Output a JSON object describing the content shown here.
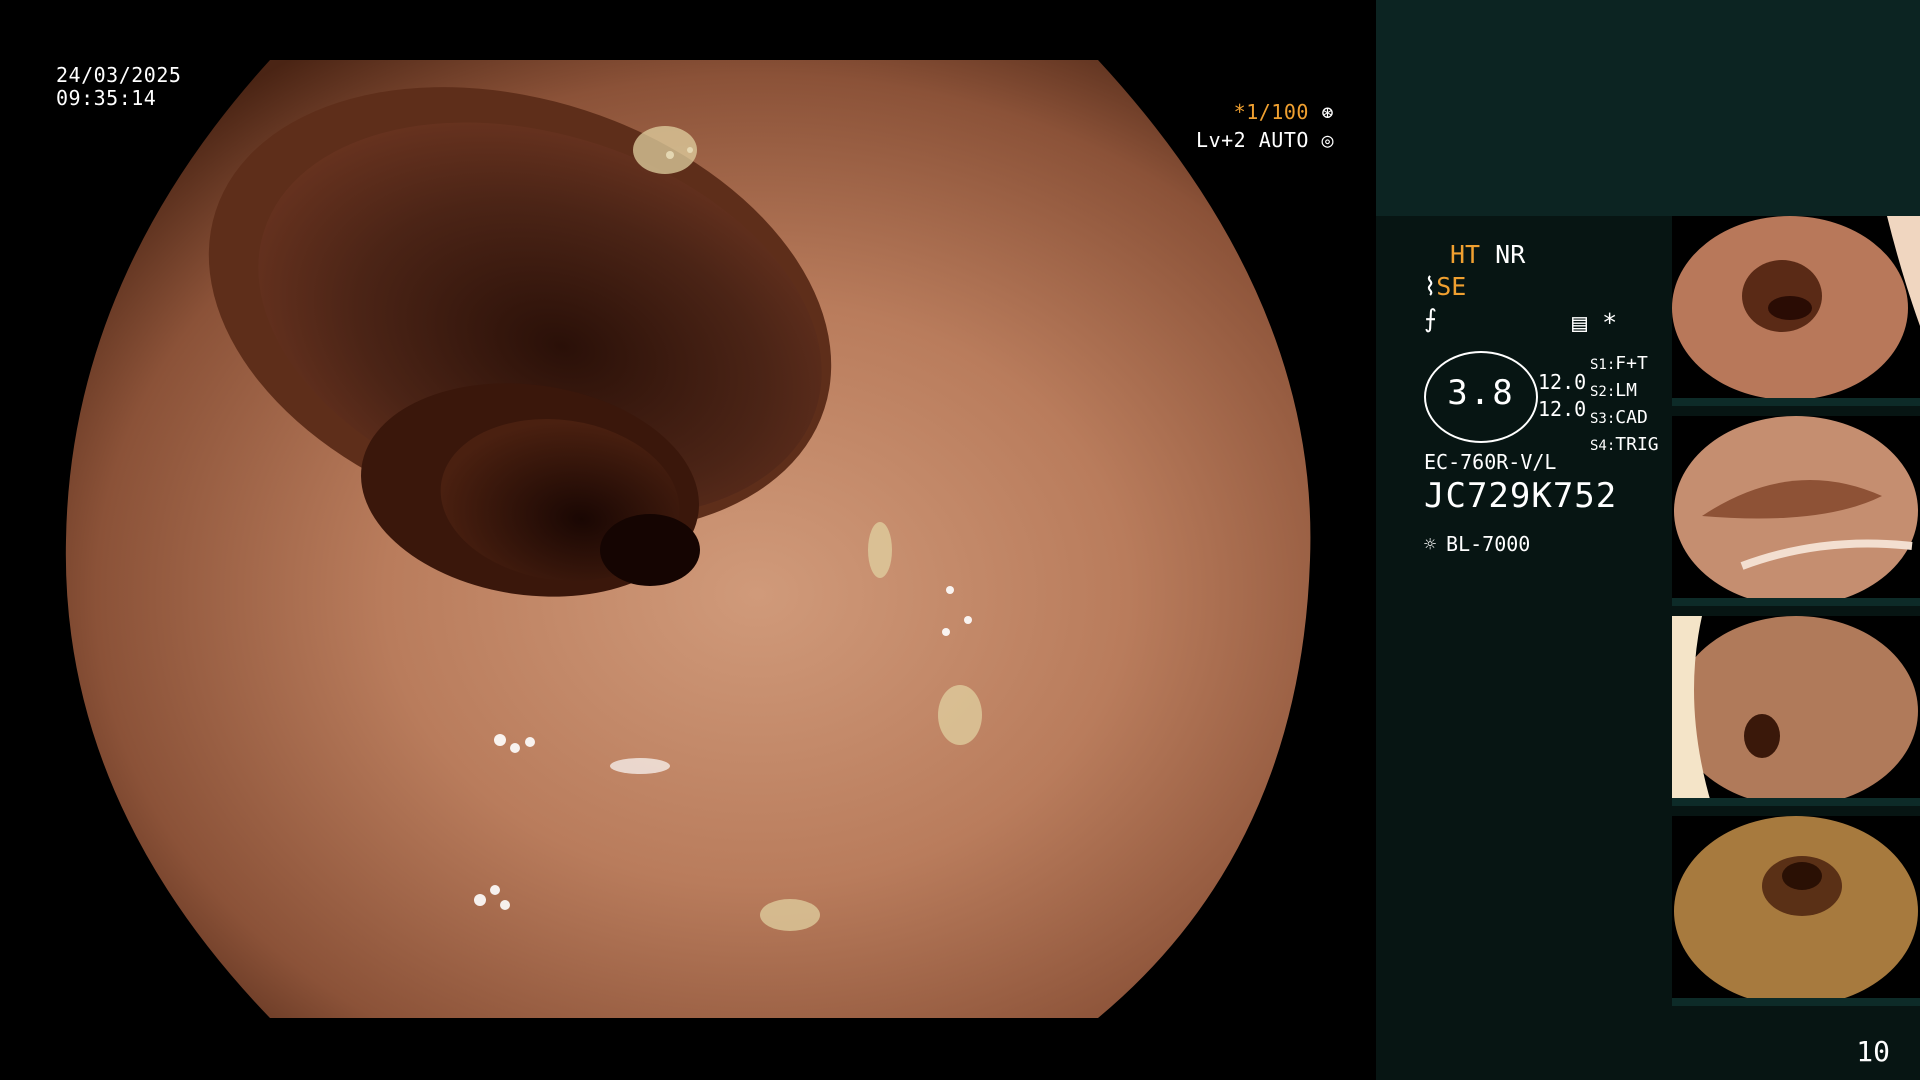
{
  "overlay": {
    "date": "24/03/2025",
    "time": "09:35:14",
    "shutter": "*1/100",
    "level_auto": "Lv+2 AUTO"
  },
  "panel": {
    "ht": "HT",
    "nr": "NR",
    "se": "SE",
    "structure_value": "3.8",
    "level_1": "12.0",
    "level_2": "12.0",
    "modes": [
      {
        "key": "S1:",
        "value": "F+T"
      },
      {
        "key": "S2:",
        "value": "LM"
      },
      {
        "key": "S3:",
        "value": "CAD"
      },
      {
        "key": "S4:",
        "value": "TRIG"
      }
    ],
    "scope_model": "EC-760R-V/L",
    "serial": "JC729K752",
    "light_source": "BL-7000",
    "star": "*"
  },
  "page_number": "10",
  "icons": [
    "shutter-icon",
    "auto-icon",
    "scope-icon",
    "enhance-icon",
    "record-icon",
    "light-icon"
  ]
}
